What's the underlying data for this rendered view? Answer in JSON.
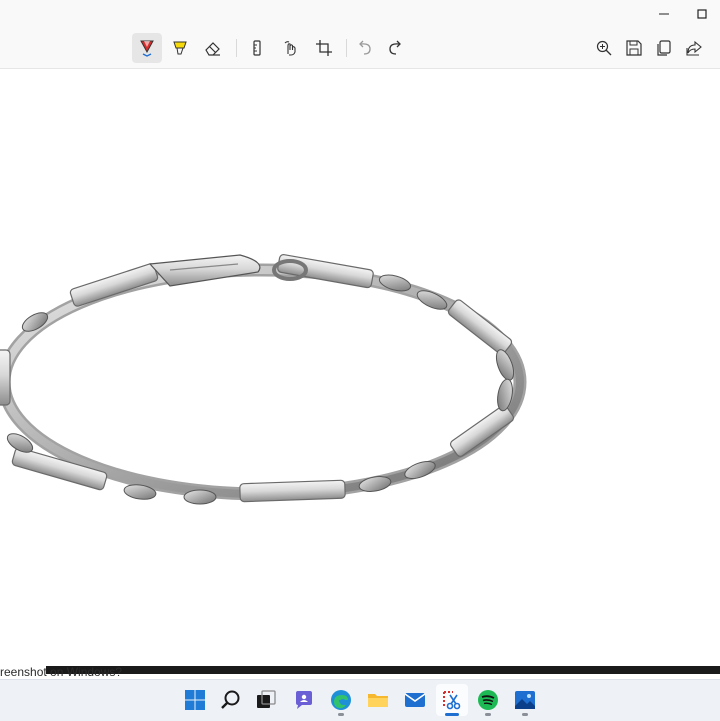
{
  "window": {
    "minimize_icon": "minimize-icon",
    "maximize_icon": "maximize-icon"
  },
  "toolbar": {
    "tools": [
      {
        "name": "ballpoint-pen",
        "icon": "pen-icon",
        "active": true
      },
      {
        "name": "highlighter",
        "icon": "highlighter-icon"
      },
      {
        "name": "eraser",
        "icon": "eraser-icon"
      },
      {
        "name": "ruler",
        "icon": "ruler-icon"
      },
      {
        "name": "touch-writing",
        "icon": "touch-writing-icon"
      },
      {
        "name": "crop",
        "icon": "crop-icon"
      },
      {
        "name": "undo",
        "icon": "undo-icon",
        "disabled": true
      },
      {
        "name": "redo",
        "icon": "redo-icon"
      }
    ],
    "right": [
      {
        "name": "zoom",
        "icon": "zoom-icon"
      },
      {
        "name": "save",
        "icon": "save-icon"
      },
      {
        "name": "copy",
        "icon": "copy-icon"
      },
      {
        "name": "share",
        "icon": "share-icon"
      }
    ],
    "pen_color": "#d92c2c",
    "highlighter_color": "#f5d90a"
  },
  "caption": {
    "text": "reenshot on Windows?"
  },
  "taskbar": {
    "items": [
      {
        "name": "start",
        "icon": "windows-start-icon"
      },
      {
        "name": "search",
        "icon": "search-icon"
      },
      {
        "name": "task-view",
        "icon": "task-view-icon"
      },
      {
        "name": "chat",
        "icon": "chat-icon"
      },
      {
        "name": "edge",
        "icon": "edge-browser-icon",
        "running": true
      },
      {
        "name": "file-explorer",
        "icon": "folder-icon"
      },
      {
        "name": "mail",
        "icon": "mail-icon"
      },
      {
        "name": "snipping-tool",
        "icon": "snipping-tool-icon",
        "running": true,
        "active": true
      },
      {
        "name": "spotify",
        "icon": "spotify-icon",
        "running": true
      },
      {
        "name": "photos",
        "icon": "photos-icon",
        "running": true
      }
    ]
  }
}
